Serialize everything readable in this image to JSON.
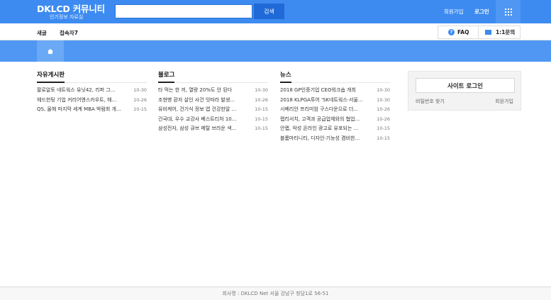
{
  "header": {
    "logo_title": "DKLCD 커뮤니티",
    "logo_subtitle": "인기정보 자료실",
    "search": {
      "value": "",
      "placeholder": "",
      "button_label": "검색"
    },
    "join_label": "회원가입",
    "login_label": "로그인",
    "menu_icon": "grid-icon",
    "accent_color": "#3d8bf0"
  },
  "subnav": {
    "new_label": "새글",
    "visitors_label": "접속자7",
    "faq_label": "FAQ",
    "ask_label": "1:1문의"
  },
  "banner": {
    "home_icon": "home-icon"
  },
  "columns": [
    {
      "title": "자유게시판",
      "items": [
        {
          "title": "팔로알토 네트웍스 유닛42, 리퍼 그...",
          "date": "10-30"
        },
        {
          "title": "헤드헌팅 기업 커리어앤스카우트, 헤...",
          "date": "10-26"
        },
        {
          "title": "QS, 올해 마지막 세계 MBA 박람회 개...",
          "date": "10-15"
        }
      ]
    },
    {
      "title": "블로그",
      "items": [
        {
          "title": "타 먹는 한 끼, 열량 20%도 안 된다",
          "date": "10-30"
        },
        {
          "title": "조현병 환자 살인 사건 잇따라 발생...",
          "date": "10-26"
        },
        {
          "title": "유비케어, 건기식 정보 앱 건강한알 ...",
          "date": "10-15"
        },
        {
          "title": "건국대, 우수 교강사 베스트티처 10...",
          "date": "10-15"
        },
        {
          "title": "삼성전자, 삼성 큐브 메탈 브라운 색...",
          "date": "10-15"
        }
      ]
    },
    {
      "title": "뉴스",
      "items": [
        {
          "title": "2018 GP인증기업 CEO워크숍 개최",
          "date": "10-30"
        },
        {
          "title": "2018 KLPGA투어 'SK네트웍스·서울...",
          "date": "10-30"
        },
        {
          "title": "시베리안 프리미엄 구스다운으로 더...",
          "date": "10-26"
        },
        {
          "title": "랩리서치, 고객과 공급업체와의 협업...",
          "date": "10-26"
        },
        {
          "title": "안랩, 악성 온라인 광고로 유포되는 ...",
          "date": "10-15"
        },
        {
          "title": "블룸마티니티, 디자인·기능성 겸비한...",
          "date": "10-15"
        }
      ]
    }
  ],
  "login_box": {
    "button_label": "사이트 로그인",
    "find_password_label": "비밀번호 찾기",
    "join_label": "회원가입"
  },
  "footer": {
    "text": "회사명 : DKLCD Net 서울 강남구 청담1로 56-51"
  }
}
